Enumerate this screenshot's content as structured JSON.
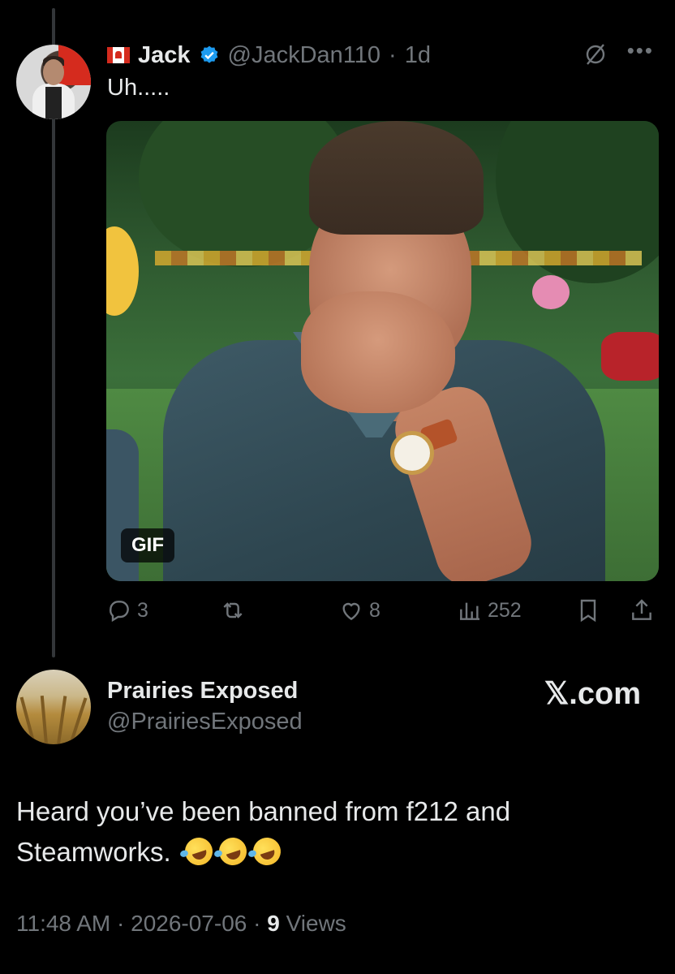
{
  "parent_tweet": {
    "name": "Jack",
    "handle": "@JackDan110",
    "separator": "·",
    "time": "1d",
    "text": "Uh.....",
    "media": {
      "badge": "GIF"
    },
    "actions": {
      "replies": "3",
      "reposts": "",
      "likes": "8",
      "views": "252"
    }
  },
  "reply": {
    "name": "Prairies Exposed",
    "handle": "@PrairiesExposed",
    "site_mark": "𝕏.com",
    "text": "Heard you’ve been banned from f212 and Steamworks.",
    "emoji": [
      "rofl",
      "rofl",
      "rofl"
    ],
    "time": "11:48 AM",
    "separator": "·",
    "date": "2026-07-06",
    "separator2": "·",
    "views_count": "9",
    "views_label": "Views"
  },
  "colors": {
    "background": "#000000",
    "text": "#e7e9ea",
    "muted": "#71767b",
    "verified": "#1d9bf0"
  }
}
